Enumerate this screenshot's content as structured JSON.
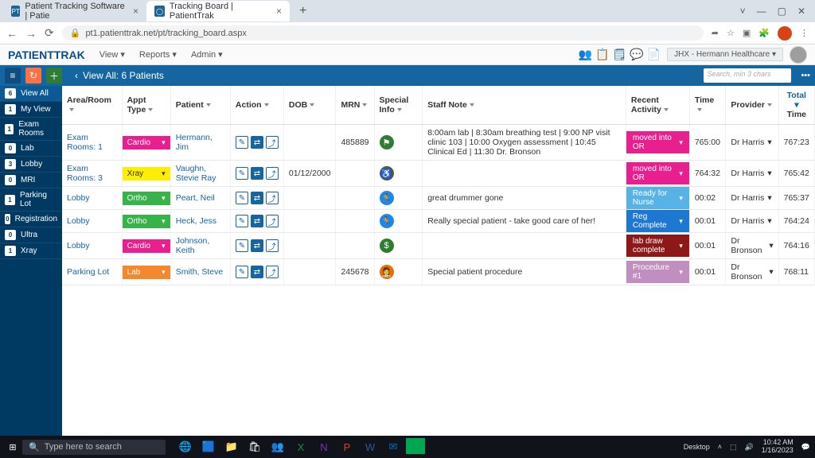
{
  "browser": {
    "tabs": [
      {
        "title": "Patient Tracking Software | Patie",
        "active": false
      },
      {
        "title": "Tracking Board | PatientTrak",
        "active": true
      }
    ],
    "url": "pt1.patienttrak.net/pt/tracking_board.aspx"
  },
  "app": {
    "logo": "PATIENTTRAK",
    "menus": [
      "View",
      "Reports",
      "Admin"
    ],
    "facility": "JHX - Hermann Healthcare"
  },
  "blue_bar": {
    "title": "View All: 6 Patients",
    "search_placeholder": "Search, min 3 chars"
  },
  "sidebar": [
    {
      "badge": "6",
      "label": "View All",
      "active": true
    },
    {
      "badge": "1",
      "label": "My View"
    },
    {
      "badge": "1",
      "label": "Exam Rooms"
    },
    {
      "badge": "0",
      "label": "Lab"
    },
    {
      "badge": "3",
      "label": "Lobby"
    },
    {
      "badge": "0",
      "label": "MRI"
    },
    {
      "badge": "1",
      "label": "Parking Lot"
    },
    {
      "badge": "0",
      "label": "Registration"
    },
    {
      "badge": "0",
      "label": "Ultra"
    },
    {
      "badge": "1",
      "label": "Xray"
    }
  ],
  "columns": [
    "Area/Room",
    "Appt Type",
    "Patient",
    "Action",
    "DOB",
    "MRN",
    "Special Info",
    "Staff Note",
    "Recent Activity",
    "Time",
    "Provider",
    "Total Time"
  ],
  "rows": [
    {
      "area": "Exam Rooms: 1",
      "appt": "Cardio",
      "appt_cls": "c-cardio",
      "patient": "Hermann, Jim",
      "dob": "",
      "mrn": "485889",
      "special": "flag",
      "special_bg": "#2e7d32",
      "note": "8:00am lab | 8:30am breathing test | 9:00 NP visit clinic 103 | 10:00 Oxygen assessment | 10:45 Clinical Ed | 11:30 Dr. Bronson",
      "recent": "moved into OR",
      "recent_cls": "r-magenta",
      "time": "765:00",
      "provider": "Dr Harris",
      "total": "767:23"
    },
    {
      "area": "Exam Rooms: 3",
      "appt": "Xray",
      "appt_cls": "c-xray",
      "patient": "Vaughn, Stevie Ray",
      "dob": "01/12/2000",
      "mrn": "",
      "special": "wheel",
      "special_bg": "#555",
      "note": "",
      "recent": "moved into OR",
      "recent_cls": "r-magenta",
      "time": "764:32",
      "provider": "Dr Harris",
      "total": "765:42"
    },
    {
      "area": "Lobby",
      "appt": "Ortho",
      "appt_cls": "c-ortho",
      "patient": "Peart, Neil",
      "dob": "",
      "mrn": "",
      "special": "run",
      "special_bg": "#1e88e5",
      "note": "great drummer gone",
      "recent": "Ready for Nurse",
      "recent_cls": "r-ltblue",
      "time": "00:02",
      "provider": "Dr Harris",
      "total": "765:37"
    },
    {
      "area": "Lobby",
      "appt": "Ortho",
      "appt_cls": "c-ortho",
      "patient": "Heck, Jess",
      "dob": "",
      "mrn": "",
      "special": "run",
      "special_bg": "#1e88e5",
      "note": "Really special patient - take good care of her!",
      "recent": "Reg Complete",
      "recent_cls": "r-blue",
      "time": "00:01",
      "provider": "Dr Harris",
      "total": "764:24"
    },
    {
      "area": "Lobby",
      "appt": "Cardio",
      "appt_cls": "c-cardio",
      "patient": "Johnson, Keith",
      "dob": "",
      "mrn": "",
      "special": "dollar",
      "special_bg": "#2e7d32",
      "note": "",
      "recent": "lab draw complete",
      "recent_cls": "r-darkred",
      "time": "00:01",
      "provider": "Dr Bronson",
      "total": "764:16"
    },
    {
      "area": "Parking Lot",
      "appt": "Lab",
      "appt_cls": "c-lab",
      "patient": "Smith, Steve",
      "dob": "",
      "mrn": "245678",
      "special": "nurse",
      "special_bg": "#ef6c00",
      "note": "Special patient procedure",
      "recent": "Procedure #1",
      "recent_cls": "r-lav",
      "time": "00:01",
      "provider": "Dr Bronson",
      "total": "768:11"
    }
  ],
  "taskbar": {
    "search_placeholder": "Type here to search",
    "desktop_label": "Desktop",
    "time": "10:42 AM",
    "date": "1/16/2023"
  }
}
